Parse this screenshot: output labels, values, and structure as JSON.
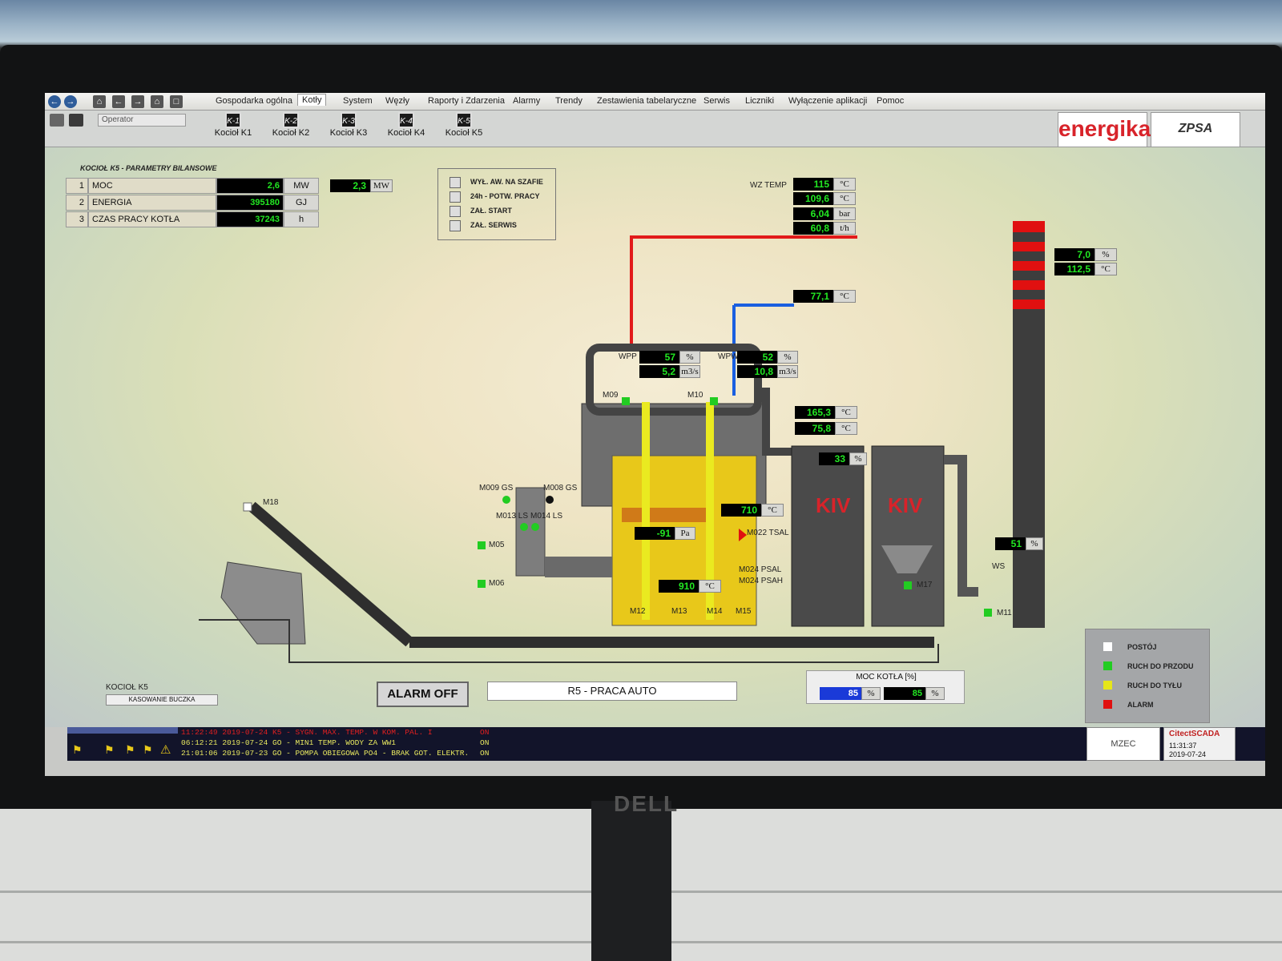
{
  "menu": {
    "items": [
      "Gospodarka ogólna",
      "Kotły",
      "System",
      "Węzły",
      "Raporty i Zdarzenia",
      "Alarmy",
      "Trendy",
      "Zestawienia tabelaryczne",
      "Serwis",
      "Liczniki",
      "Wyłączenie aplikacji",
      "Pomoc"
    ],
    "active": "Kotły"
  },
  "toolbar": {
    "operator": "Operator",
    "boilers": [
      {
        "icon": "K-1",
        "label": "Kocioł K1"
      },
      {
        "icon": "K-2",
        "label": "Kocioł K2"
      },
      {
        "icon": "K-3",
        "label": "Kocioł K3"
      },
      {
        "icon": "K-4",
        "label": "Kocioł K4"
      },
      {
        "icon": "K-5",
        "label": "Kocioł K5"
      }
    ]
  },
  "logos": {
    "energika": "energika",
    "zpsa": "ZPSA"
  },
  "balance": {
    "title": "KOCIOŁ K5 - PARAMETRY BILANSOWE",
    "rows": [
      {
        "no": "1",
        "name": "MOC",
        "value": "2,6",
        "unit": "MW"
      },
      {
        "no": "2",
        "name": "ENERGIA",
        "value": "395180",
        "unit": "GJ"
      },
      {
        "no": "3",
        "name": "CZAS PRACY KOTŁA",
        "value": "37243",
        "unit": "h"
      }
    ],
    "extra_value": "2,3",
    "extra_unit": "MW"
  },
  "checks": [
    "WYŁ. AW. NA SZAFIE",
    "24h - POTW. PRACY",
    "ZAŁ. START",
    "ZAŁ. SERWIS"
  ],
  "wz": {
    "label": "WZ TEMP",
    "values": [
      {
        "v": "115",
        "u": "°C"
      },
      {
        "v": "109,6",
        "u": "°C"
      },
      {
        "v": "6,04",
        "u": "bar"
      },
      {
        "v": "60,8",
        "u": "t/h"
      }
    ]
  },
  "return_temp": {
    "v": "77,1",
    "u": "°C"
  },
  "stack": {
    "values": [
      {
        "v": "7,0",
        "u": "%"
      },
      {
        "v": "112,5",
        "u": "°C"
      }
    ]
  },
  "wpp": {
    "label": "WPP",
    "pct": "57",
    "flow": "5,2",
    "u1": "%",
    "u2": "m3/s"
  },
  "wpw": {
    "label": "WPW",
    "pct": "52",
    "flow": "10,8",
    "u1": "%",
    "u2": "m3/s"
  },
  "flue": {
    "t1": "165,3",
    "t2": "75,8",
    "u": "°C"
  },
  "filter_pct": {
    "v": "33",
    "u": "%"
  },
  "fan_pct": {
    "v": "51",
    "u": "%"
  },
  "furnace": {
    "temp": "710",
    "temp_u": "°C",
    "press": "-91",
    "press_u": "Pa",
    "grate_temp": "910",
    "grate_u": "°C"
  },
  "labels": {
    "m18": "M18",
    "m009": "M009 GS",
    "m008": "M008 GS",
    "m013": "M013 LS",
    "m014": "M014 LS",
    "m05": "M05",
    "m06": "M06",
    "m09": "M09",
    "m10": "M10",
    "m12": "M12",
    "m13": "M13",
    "m14": "M14",
    "m15": "M15",
    "m17": "M17",
    "m11": "M11",
    "ws": "WS",
    "m022": "M022 TSAL",
    "m024a": "M024 PSAL",
    "m024b": "M024 PSAH",
    "kiv": "KIV"
  },
  "legend": [
    {
      "label": "POSTÓJ",
      "color": "#ffffff"
    },
    {
      "label": "RUCH DO PRZODU",
      "color": "#22cc22"
    },
    {
      "label": "RUCH DO TYŁU",
      "color": "#e6e61a"
    },
    {
      "label": "ALARM",
      "color": "#e01010"
    }
  ],
  "boiler_footer": {
    "title": "KOCIOŁ K5",
    "reset": "KASOWANIE BUCZKA"
  },
  "alarm_off": "ALARM OFF",
  "mode": "R5 - PRACA AUTO",
  "power": {
    "title": "MOC KOTŁA [%]",
    "set": "85",
    "actual": "85",
    "u": "%"
  },
  "alarms": [
    {
      "time": "11:22:49",
      "text": "2019-07-24 K5 - SYGN. MAX. TEMP. W KOM. PAL. I",
      "state": "ON",
      "color": "#e02020"
    },
    {
      "time": "06:12:21",
      "text": "2019-07-24 GO - MIN1 TEMP. WODY ZA WW1",
      "state": "ON",
      "color": "#e8e860"
    },
    {
      "time": "21:01:06",
      "text": "2019-07-23 GO - POMPA OBIEGOWA PO4 - BRAK GOT. ELEKTR.",
      "state": "ON",
      "color": "#e8e860"
    }
  ],
  "footer": {
    "mzec": "MZEC",
    "citect": "CitectSCADA",
    "clock": "11:31:37",
    "date": "2019-07-24"
  },
  "monitor_brand": "DELL"
}
